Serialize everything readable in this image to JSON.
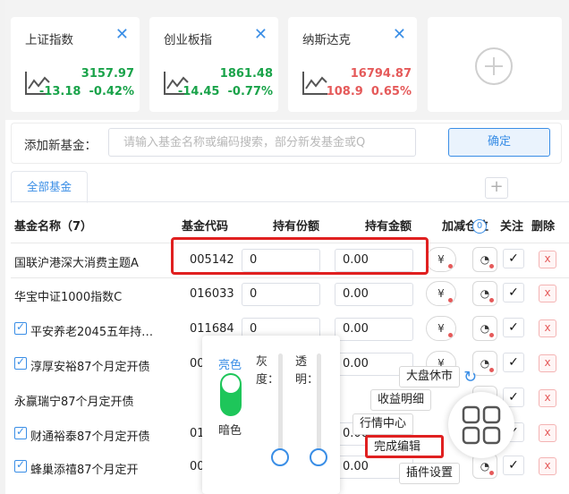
{
  "cards": [
    {
      "title": "上证指数",
      "close": "✕",
      "price": "3157.97",
      "change": "-13.18",
      "pct": "-0.42%",
      "color": "green"
    },
    {
      "title": "创业板指",
      "close": "✕",
      "price": "1861.48",
      "change": "-14.45",
      "pct": "-0.77%",
      "color": "green"
    },
    {
      "title": "纳斯达克",
      "close": "✕",
      "price": "16794.87",
      "change": "108.9",
      "pct": "0.65%",
      "color": "red"
    }
  ],
  "add_fund": {
    "label": "添加新基金：",
    "placeholder": "请输入基金名称或编码搜索，部分新发基金或Q",
    "confirm": "确定"
  },
  "tabs": {
    "active": "全部基金",
    "add": "+"
  },
  "table": {
    "headers": {
      "name": "基金名称（7）",
      "code": "基金代码",
      "shares": "持有份额",
      "amount": "持有金额",
      "adjust": "加减仓位",
      "follow": "关注",
      "delete": "删除"
    },
    "badge": "0",
    "rows": [
      {
        "name": "国联沪港深大消费主题A",
        "code": "005142",
        "shares": "0",
        "amount": "0.00",
        "checked": false
      },
      {
        "name": "华宝中证1000指数C",
        "code": "016033",
        "shares": "0",
        "amount": "0.00",
        "checked": false
      },
      {
        "name": "平安养老2045五年持…",
        "code": "011684",
        "shares": "0",
        "amount": "0.00",
        "checked": true
      },
      {
        "name": "淳厚安裕87个月定开债",
        "code": "00",
        "shares": "",
        "amount": "0.00",
        "checked": true
      },
      {
        "name": "永赢瑞宁87个月定开债",
        "code": "",
        "shares": "",
        "amount": "",
        "checked": false
      },
      {
        "name": "财通裕泰87个月定开债",
        "code": "01",
        "shares": "",
        "amount": "0.00",
        "checked": true
      },
      {
        "name": "蜂巢添禧87个月定开",
        "code": "00",
        "shares": "",
        "amount": "0.00",
        "checked": true
      }
    ],
    "check_mark": "✓",
    "delete_mark": "x"
  },
  "theme_panel": {
    "light": "亮色",
    "dark": "暗色",
    "gray": "灰度：",
    "transparent": "透明："
  },
  "floating_menu": {
    "market_rest": "大盘休市",
    "income": "收益明细",
    "market_center": "行情中心",
    "finish_edit": "完成编辑",
    "plugin_settings": "插件设置"
  },
  "colors": {
    "accent": "#3a8ee6",
    "up": "#e55a5a",
    "down": "#1aa34a",
    "toggle": "#1ec65a",
    "highlight": "#e02020"
  }
}
